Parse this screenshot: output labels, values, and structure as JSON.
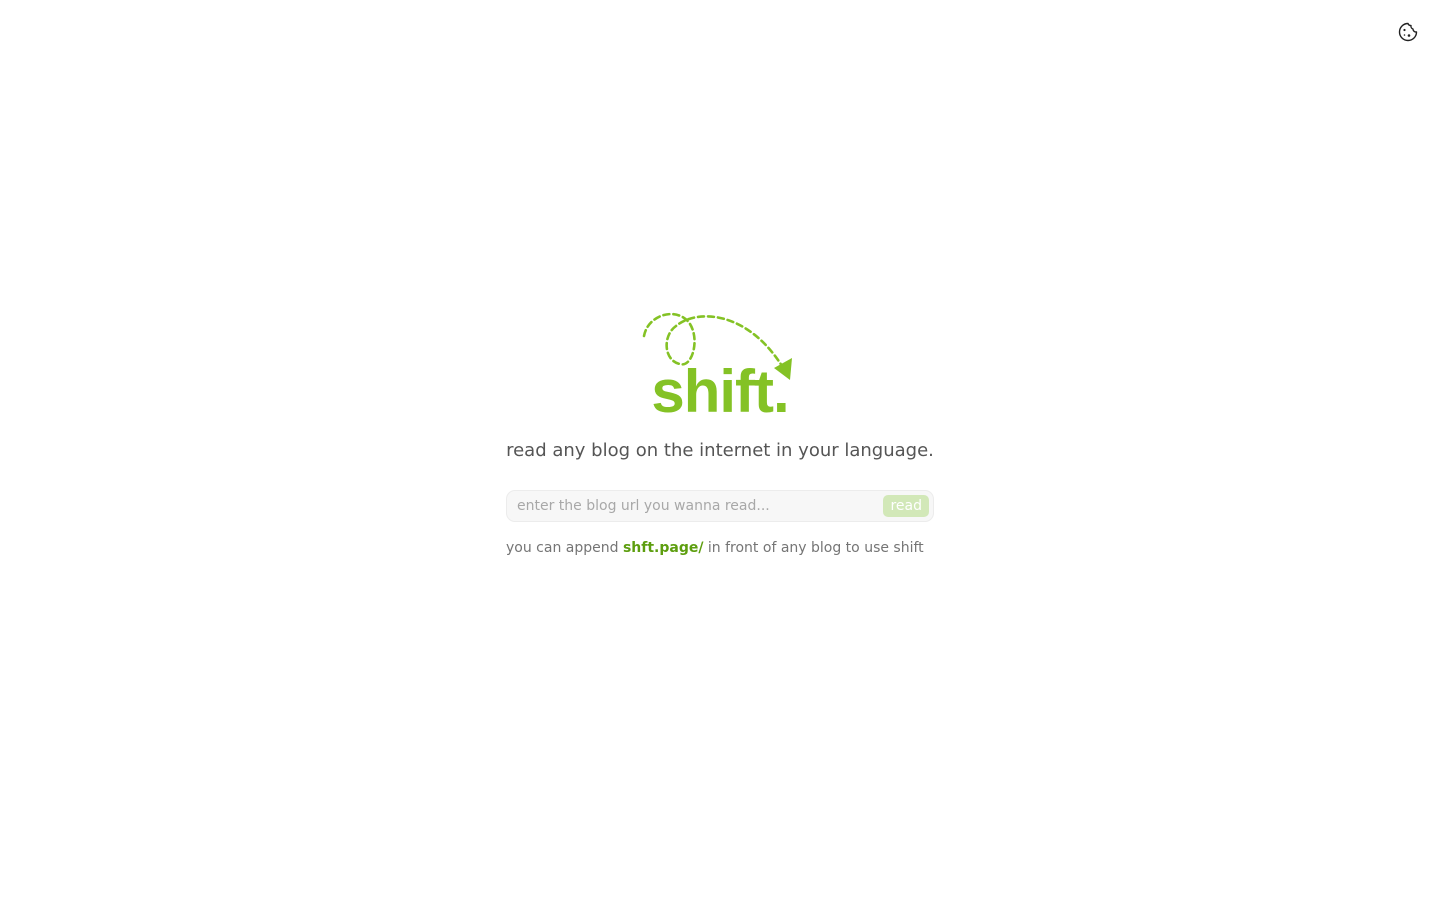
{
  "header": {
    "theme_toggle_icon": "cookie-icon"
  },
  "brand": {
    "logo_text": "shift.",
    "logo_color": "#84c225",
    "tagline": "read any blog on the internet in your language."
  },
  "search": {
    "placeholder": "enter the blog url you wanna read...",
    "value": "",
    "button_label": "read"
  },
  "hint": {
    "prefix": "you can append",
    "highlight": "shft.page/",
    "suffix": "in front of any blog to use shift"
  }
}
